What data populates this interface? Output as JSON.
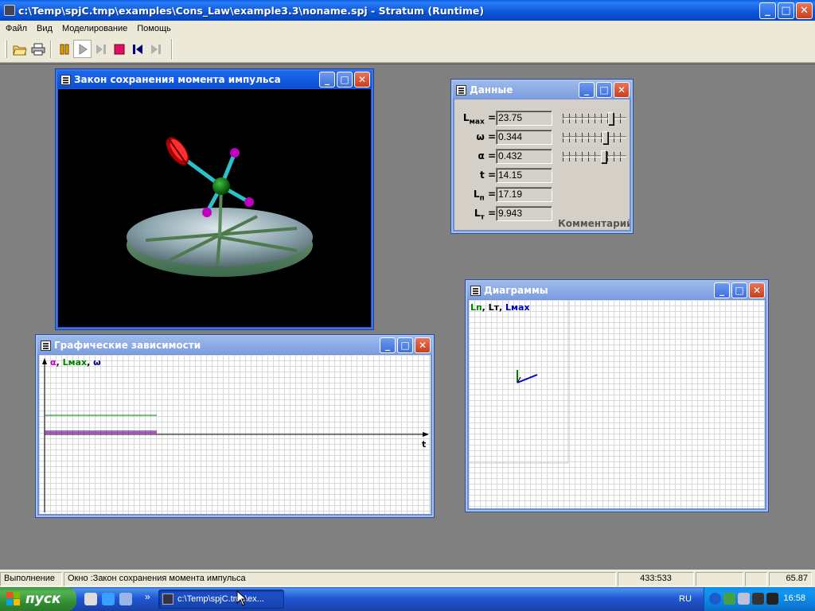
{
  "app": {
    "title": "c:\\Temp\\spjC.tmp\\examples\\Cons_Law\\example3.3\\noname.spj - Stratum (Runtime)",
    "window_buttons": {
      "minimize": "_",
      "maximize": "□",
      "close": "✕"
    }
  },
  "menu": {
    "items": [
      "Файл",
      "Вид",
      "Моделирование",
      "Помощь"
    ]
  },
  "toolbar": {
    "buttons": [
      "open-icon",
      "print-icon",
      "pause-icon",
      "play-icon",
      "step-icon",
      "stop-icon",
      "step-back-icon",
      "step-forward-icon"
    ]
  },
  "windows": {
    "model": {
      "title": "Закон сохранения момента импульса"
    },
    "data": {
      "title": "Данные",
      "rows": [
        {
          "label": "L",
          "sub": "мах",
          "value": "23.75",
          "slider": 0.74
        },
        {
          "label": "ω",
          "sub": "",
          "value": "0.344",
          "slider": 0.65
        },
        {
          "label": "α",
          "sub": "",
          "value": "0.432",
          "slider": 0.63
        },
        {
          "label": "t",
          "sub": "",
          "value": "14.15"
        },
        {
          "label": "L",
          "sub": "п",
          "value": "17.19"
        },
        {
          "label": "L",
          "sub": "т",
          "value": "9.943"
        }
      ],
      "comment_label": "Комментарий"
    },
    "graphs": {
      "title": "Графические зависимости",
      "legend": [
        "α",
        "Lмах",
        "ω"
      ],
      "legend_colors": [
        "#c000c0",
        "#008000",
        "#000080"
      ],
      "x_axis_label": "t"
    },
    "diagrams": {
      "title": "Диаграммы",
      "legend": [
        "Lп",
        "Lт",
        "Lмах"
      ],
      "legend_colors": [
        "#008000",
        "#000000",
        "#0000c0"
      ]
    }
  },
  "statusbar": {
    "mode": "Выполнение",
    "window_info": "Окно :Закон сохранения момента импульса",
    "coords": "433:533",
    "value": "65.87"
  },
  "taskbar": {
    "start_label": "пуск",
    "task_label": "c:\\Temp\\spjC.tmp\\ex...",
    "chevron": "»",
    "language": "RU",
    "clock": "16:58"
  }
}
